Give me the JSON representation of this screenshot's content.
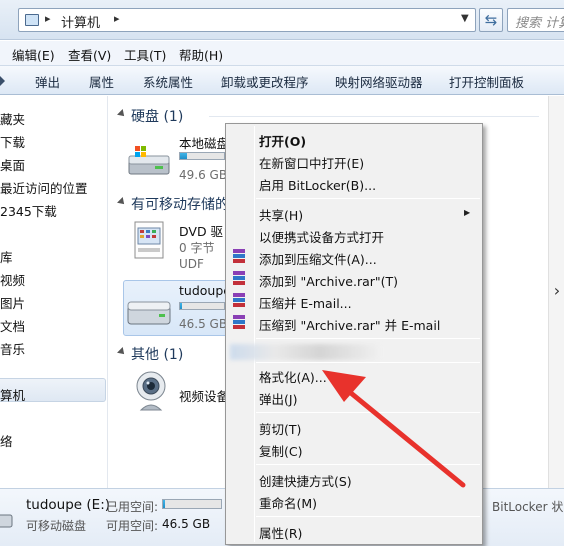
{
  "address_bar": {
    "path": "计算机",
    "search_placeholder": "搜索 计算机"
  },
  "menu": [
    "编辑(E)",
    "查看(V)",
    "工具(T)",
    "帮助(H)"
  ],
  "toolbar": [
    "弹出",
    "属性",
    "系统属性",
    "卸载或更改程序",
    "映射网络驱动器",
    "打开控制面板"
  ],
  "nav": [
    "藏夹",
    "下载",
    "桌面",
    "最近访问的位置",
    "2345下载",
    "库",
    "视频",
    "图片",
    "文档",
    "音乐",
    "算机",
    "络"
  ],
  "content": {
    "group_hdd": "硬盘 (1)",
    "local_disk_name": "本地磁盘",
    "local_disk_free": "49.6 GB",
    "local_disk_used_fraction": 0.15,
    "group_removable": "有可移动存储的",
    "dvd_name": "DVD 驱",
    "dvd_size": "0 字节",
    "dvd_fs": "UDF",
    "usb_name": "tudoupe",
    "usb_free": "46.5 GB",
    "usb_used_fraction": 0.04,
    "group_other": "其他 (1)",
    "video_device": "视频设备"
  },
  "context_menu": {
    "open": "打开(O)",
    "open_new_window": "在新窗口中打开(E)",
    "bitlocker": "启用 BitLocker(B)...",
    "share": "共享(H)",
    "portable_open": "以便携式设备方式打开",
    "add_archive": "添加到压缩文件(A)...",
    "add_rar": "添加到 \"Archive.rar\"(T)",
    "compress_email": "压缩并 E-mail...",
    "compress_rar_email": "压缩到 \"Archive.rar\" 并 E-mail",
    "format": "格式化(A)...",
    "eject": "弹出(J)",
    "cut": "剪切(T)",
    "copy": "复制(C)",
    "create_shortcut": "创建快捷方式(S)",
    "rename": "重命名(M)",
    "properties": "属性(R)"
  },
  "details": {
    "name": "tudoupe (E:)",
    "type": "可移动磁盘",
    "used_label": "已用空间:",
    "free_label": "可用空间:",
    "free_value": "46.5 GB",
    "bitlocker_status": "BitLocker 状",
    "used_fraction": 0.04
  },
  "colors": {
    "annotation_arrow": "#e8322c",
    "drive_bar_fill": "#26a0da"
  }
}
